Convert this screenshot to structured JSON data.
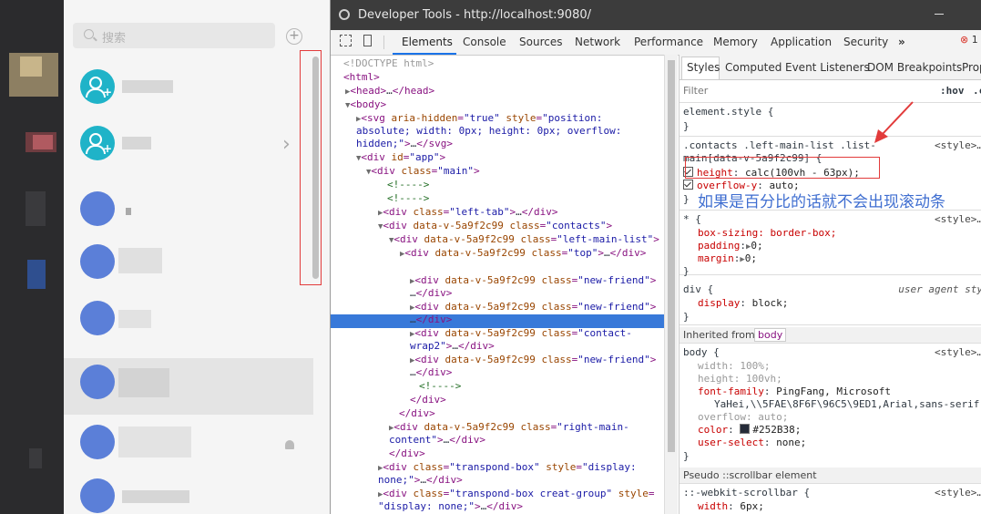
{
  "app": {
    "search_placeholder": "搜索",
    "add_button": "+"
  },
  "devtools": {
    "title": "Developer Tools - http://localhost:9080/",
    "tabs": [
      "Elements",
      "Console",
      "Sources",
      "Network",
      "Performance",
      "Memory",
      "Application",
      "Security"
    ],
    "more_tabs": "»",
    "error_icon": "⊗",
    "error_count": "1",
    "tree": [
      {
        "indent": 0,
        "html": "<!DOCTYPE html>",
        "cls": "dis"
      },
      {
        "indent": 0,
        "tag": "<html>"
      },
      {
        "indent": 0,
        "arrow": "▶",
        "tag": "<head>…</head>"
      },
      {
        "indent": 0,
        "arrow": "▼",
        "tag": "<body>"
      }
    ],
    "styles_tabs": [
      "Styles",
      "Computed",
      "Event Listeners",
      "DOM Breakpoints",
      "Prop"
    ],
    "filter_placeholder": "Filter",
    "hov": ":hov",
    "cls_dot": ".c",
    "element_style": "element.style {",
    "close_brace": "}",
    "rule1_selector": ".contacts .left-main-list .list-",
    "rule1_selector2": "main[data-v-5a9f2c99] {",
    "rule1_source": "<style>…",
    "rule1_p1_name": "height",
    "rule1_p1_value": "calc(100vh - 63px);",
    "rule1_p2_name": "overflow-y",
    "rule1_p2_value": "auto;",
    "annotation": "如果是百分比的话就不会出现滚动条",
    "rule2_selector": "* {",
    "rule2_source": "<style>…",
    "rule2_p1": "box-sizing: border-box;",
    "rule2_p2_name": "padding",
    "rule2_p2_value": "0;",
    "rule2_p3_name": "margin",
    "rule2_p3_value": "0;",
    "rule3_selector": "div {",
    "rule3_source": "user agent sty",
    "rule3_p1_name": "display",
    "rule3_p1_value": "block;",
    "inherited_label": "Inherited from",
    "inherited_chip": "body",
    "body_selector": "body {",
    "body_source": "<style>…",
    "body_width": "width: 100%;",
    "body_height": "height: 100vh;",
    "body_ff_name": "font-family",
    "body_ff_value": "PingFang, Microsoft",
    "body_ff_value2": "YaHei,\\\\5FAE\\8F6F\\96C5\\9ED1,Arial,sans-serif",
    "body_overflow": "overflow: auto;",
    "body_color_name": "color",
    "body_color_value": "#252B38;",
    "body_us_name": "user-select",
    "body_us_value": "none;",
    "pseudo_label": "Pseudo ::scrollbar element",
    "pseudo_selector": "::-webkit-scrollbar {",
    "pseudo_source": "<style>…",
    "pseudo_width_name": "width",
    "pseudo_width_value": "6px;"
  },
  "colors": {
    "selection": "#3879d9",
    "annotation": "#3f6ed0",
    "highlight_box": "#e23b3b",
    "body_text_color": "#252b38"
  }
}
